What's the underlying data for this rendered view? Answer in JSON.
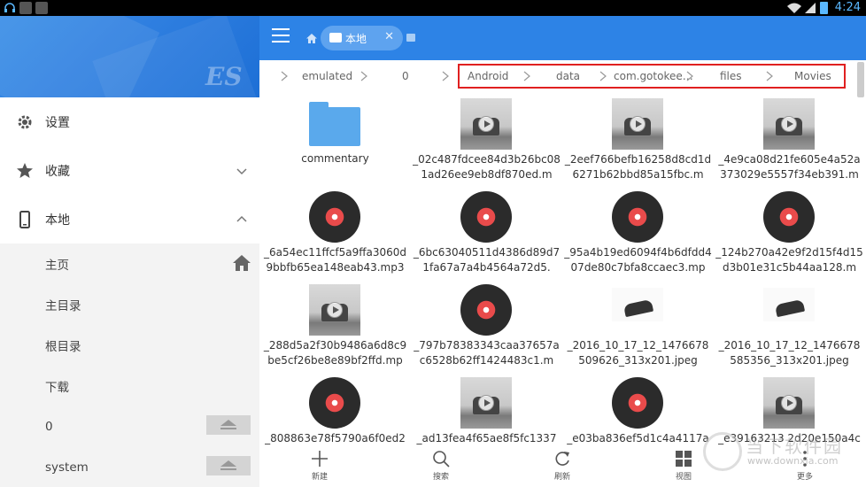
{
  "status_bar": {
    "time": "4:24",
    "left_icons": [
      "headset-icon",
      "k-icon",
      "k-icon"
    ],
    "right_icons": [
      "wifi-icon",
      "signal-icon",
      "battery-icon"
    ]
  },
  "sidebar": {
    "logo_text": "ES",
    "items": [
      {
        "label": "设置",
        "icon": "gear-icon"
      },
      {
        "label": "收藏",
        "icon": "star-icon",
        "chevron": "down"
      },
      {
        "label": "本地",
        "icon": "phone-icon",
        "chevron": "up"
      }
    ],
    "sub_items": [
      {
        "label": "主页",
        "trailing": "home-icon"
      },
      {
        "label": "主目录"
      },
      {
        "label": "根目录"
      },
      {
        "label": "下载"
      },
      {
        "label": "0",
        "trailing": "eject-icon"
      },
      {
        "label": "system",
        "trailing": "eject-icon"
      }
    ]
  },
  "toolbar": {
    "tab_label": "本地",
    "tab_close": "✕"
  },
  "breadcrumb": {
    "items": [
      "emulated",
      "0",
      "Android",
      "data",
      "com.gotokee…",
      "files",
      "Movies"
    ]
  },
  "files": [
    {
      "name": "commentary",
      "type": "folder"
    },
    {
      "name": "_02c487fdcee84d3b26bc081ad26ee9eb8df870ed.m",
      "type": "video"
    },
    {
      "name": "_2eef766befb16258d8cd1d6271b62bbd85a15fbc.m",
      "type": "video"
    },
    {
      "name": "_4e9ca08d21fe605e4a52a373029e5557f34eb391.m",
      "type": "video"
    },
    {
      "name": "_6a54ec11ffcf5a9ffa3060d9bbfb65ea148eab43.mp3",
      "type": "audio"
    },
    {
      "name": "_6bc63040511d4386d89d71fa67a7a4b4564a72d5.",
      "type": "audio"
    },
    {
      "name": "_95a4b19ed6094f4b6dfdd407de80c7bfa8ccaec3.mp",
      "type": "audio"
    },
    {
      "name": "_124b270a42e9f2d15f4d15d3b01e31c5b44aa128.m",
      "type": "audio"
    },
    {
      "name": "_288d5a2f30b9486a6d8c9be5cf26be8e89bf2ffd.mp",
      "type": "video"
    },
    {
      "name": "_797b78383343caa37657ac6528b62ff1424483c1.m",
      "type": "audio"
    },
    {
      "name": "_2016_10_17_12_1476678509626_313x201.jpeg",
      "type": "jpeg"
    },
    {
      "name": "_2016_10_17_12_1476678585356_313x201.jpeg",
      "type": "jpeg"
    },
    {
      "name": "_808863e78f5790a6f0ed2",
      "type": "audio"
    },
    {
      "name": "_ad13fea4f65ae8f5fc1337",
      "type": "video"
    },
    {
      "name": "_e03ba836ef5d1c4a4117a",
      "type": "audio"
    },
    {
      "name": "_e39163213 2d20e150a4c",
      "type": "video"
    }
  ],
  "bottom_bar": [
    {
      "label": "新建",
      "icon": "plus-icon"
    },
    {
      "label": "搜索",
      "icon": "search-icon"
    },
    {
      "label": "刷新",
      "icon": "refresh-icon"
    },
    {
      "label": "视图",
      "icon": "grid-view-icon"
    },
    {
      "label": "更多",
      "icon": "more-icon"
    }
  ],
  "watermark": {
    "text_main": "当下软件园",
    "text_url": "www.downxia.com"
  },
  "colors": {
    "toolbar_blue": "#2d83e6",
    "tab_blue": "#5ea3ef",
    "highlight_red": "#e02020",
    "folder_blue": "#5aa9ec",
    "disc_red": "#e94b4b",
    "time_blue": "#5ab8ff"
  }
}
